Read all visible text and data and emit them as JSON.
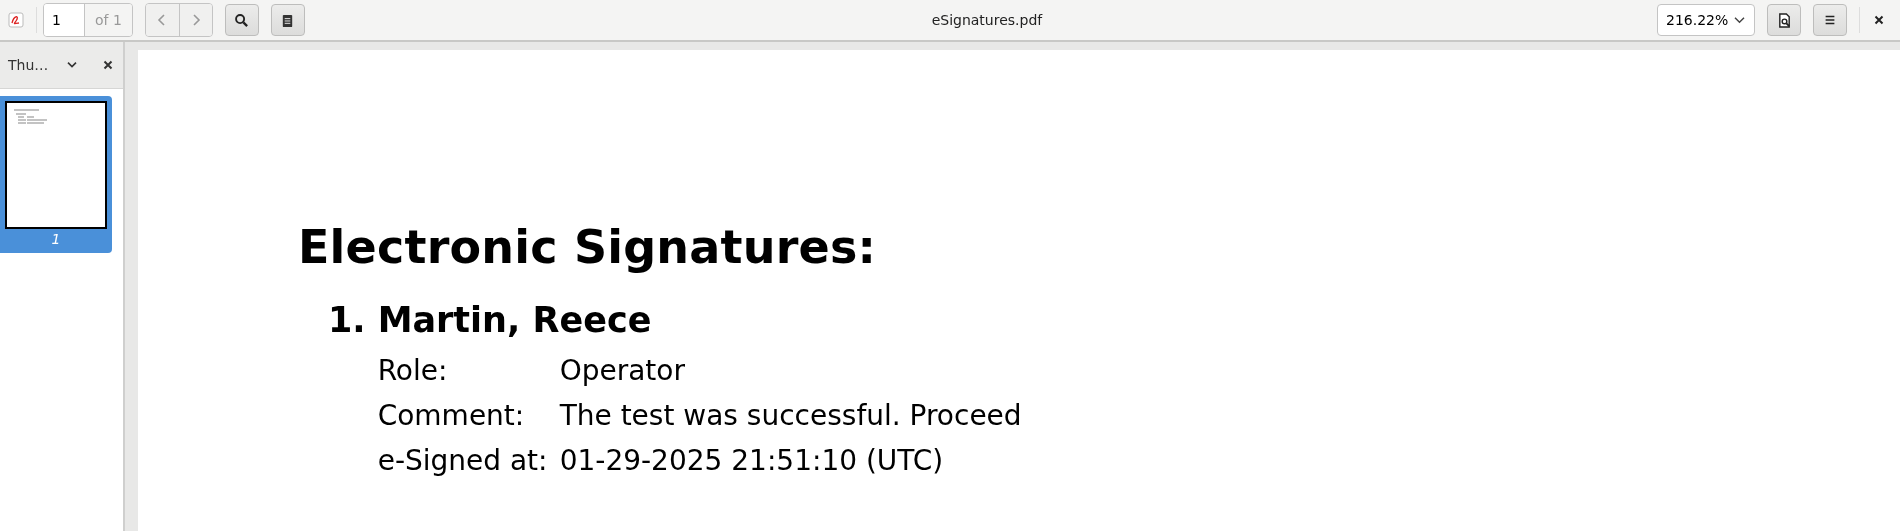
{
  "toolbar": {
    "page_number": "1",
    "page_count": "of 1",
    "title": "eSignatures.pdf",
    "zoom": "216.22%"
  },
  "sidebar": {
    "view": "Thu…",
    "thumbnails": [
      {
        "label": "1",
        "selected": true
      }
    ]
  },
  "document": {
    "heading": "Electronic Signatures:",
    "signatures": [
      {
        "number": "1.",
        "name": "Martin, Reece",
        "fields": [
          {
            "label": "Role:",
            "value": "Operator"
          },
          {
            "label": "Comment:",
            "value": "The test was successful. Proceed"
          },
          {
            "label": "e-Signed at:",
            "value": "01-29-2025 21:51:10 (UTC)"
          }
        ]
      }
    ]
  }
}
